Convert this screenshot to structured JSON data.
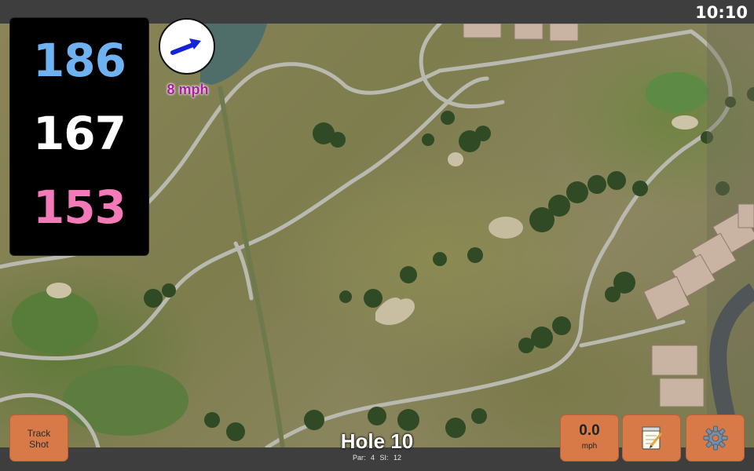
{
  "status_bar": {
    "time": "10:10"
  },
  "distances": {
    "back": "186",
    "middle": "167",
    "front": "153"
  },
  "wind": {
    "speed_label": "8 mph",
    "icon": "wind-direction-arrow-icon"
  },
  "hole": {
    "title": "Hole 10",
    "par_label": "Par: 4",
    "si_label": "SI: 12"
  },
  "buttons": {
    "track_shot_line1": "Track",
    "track_shot_line2": "Shot",
    "speed_value": "0.0",
    "speed_unit": "mph",
    "notes_icon": "notepad-icon",
    "settings_icon": "gear-icon"
  },
  "colors": {
    "back": "#6fb2f2",
    "middle": "#ffffff",
    "front": "#f37ab8",
    "wind_label": "#b01aa6",
    "button": "#d77a48"
  }
}
